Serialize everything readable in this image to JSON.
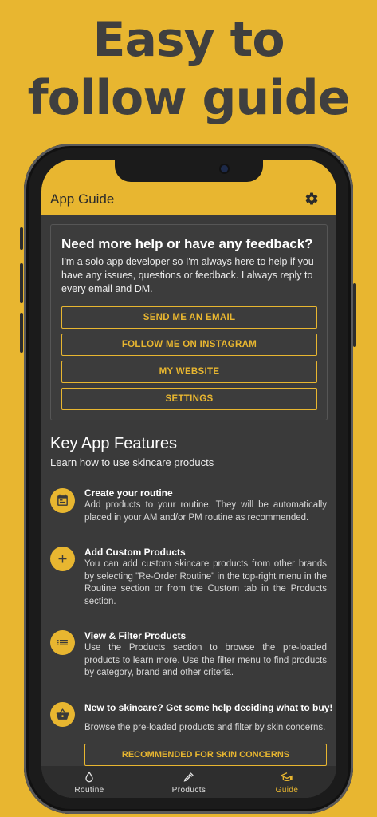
{
  "headline": {
    "line1": "Easy to",
    "line2": "follow guide"
  },
  "appbar": {
    "title": "App Guide",
    "settings_icon": "gear-icon"
  },
  "help_card": {
    "heading": "Need more help or have any feedback?",
    "body": "I'm a solo app developer so I'm always here to help if you have any issues, questions or feedback. I always reply to every email and DM.",
    "buttons": [
      "SEND ME AN EMAIL",
      "FOLLOW ME ON INSTAGRAM",
      "MY WEBSITE",
      "SETTINGS"
    ]
  },
  "features_section": {
    "title": "Key App Features",
    "subtitle": "Learn how to use skincare products",
    "items": [
      {
        "icon": "calendar-icon",
        "title": "Create your routine",
        "desc": "Add products to your routine. They will be automatically placed in your AM and/or PM routine as recommended."
      },
      {
        "icon": "plus-icon",
        "title": "Add Custom Products",
        "desc": "You can add custom skincare products from other brands by selecting \"Re-Order Routine\" in the top-right menu in the Routine section or from the Custom tab in the Products section."
      },
      {
        "icon": "list-icon",
        "title": "View & Filter Products",
        "desc": "Use the Products section to browse the pre-loaded products to learn more. Use the filter menu to find products by category, brand and other criteria."
      },
      {
        "icon": "basket-icon",
        "title": "New to skincare? Get some help deciding what to buy!",
        "desc": "Browse the pre-loaded products and filter by skin concerns."
      }
    ],
    "recommended_button": "RECOMMENDED FOR SKIN CONCERNS"
  },
  "bottom_nav": {
    "items": [
      {
        "label": "Routine",
        "icon": "drop-icon"
      },
      {
        "label": "Products",
        "icon": "dropper-icon"
      },
      {
        "label": "Guide",
        "icon": "graduation-cap-icon"
      }
    ],
    "active": "Guide"
  },
  "colors": {
    "accent": "#e8b630",
    "screen_bg": "#3a3a3a",
    "text_dark": "#3f3f3f"
  }
}
